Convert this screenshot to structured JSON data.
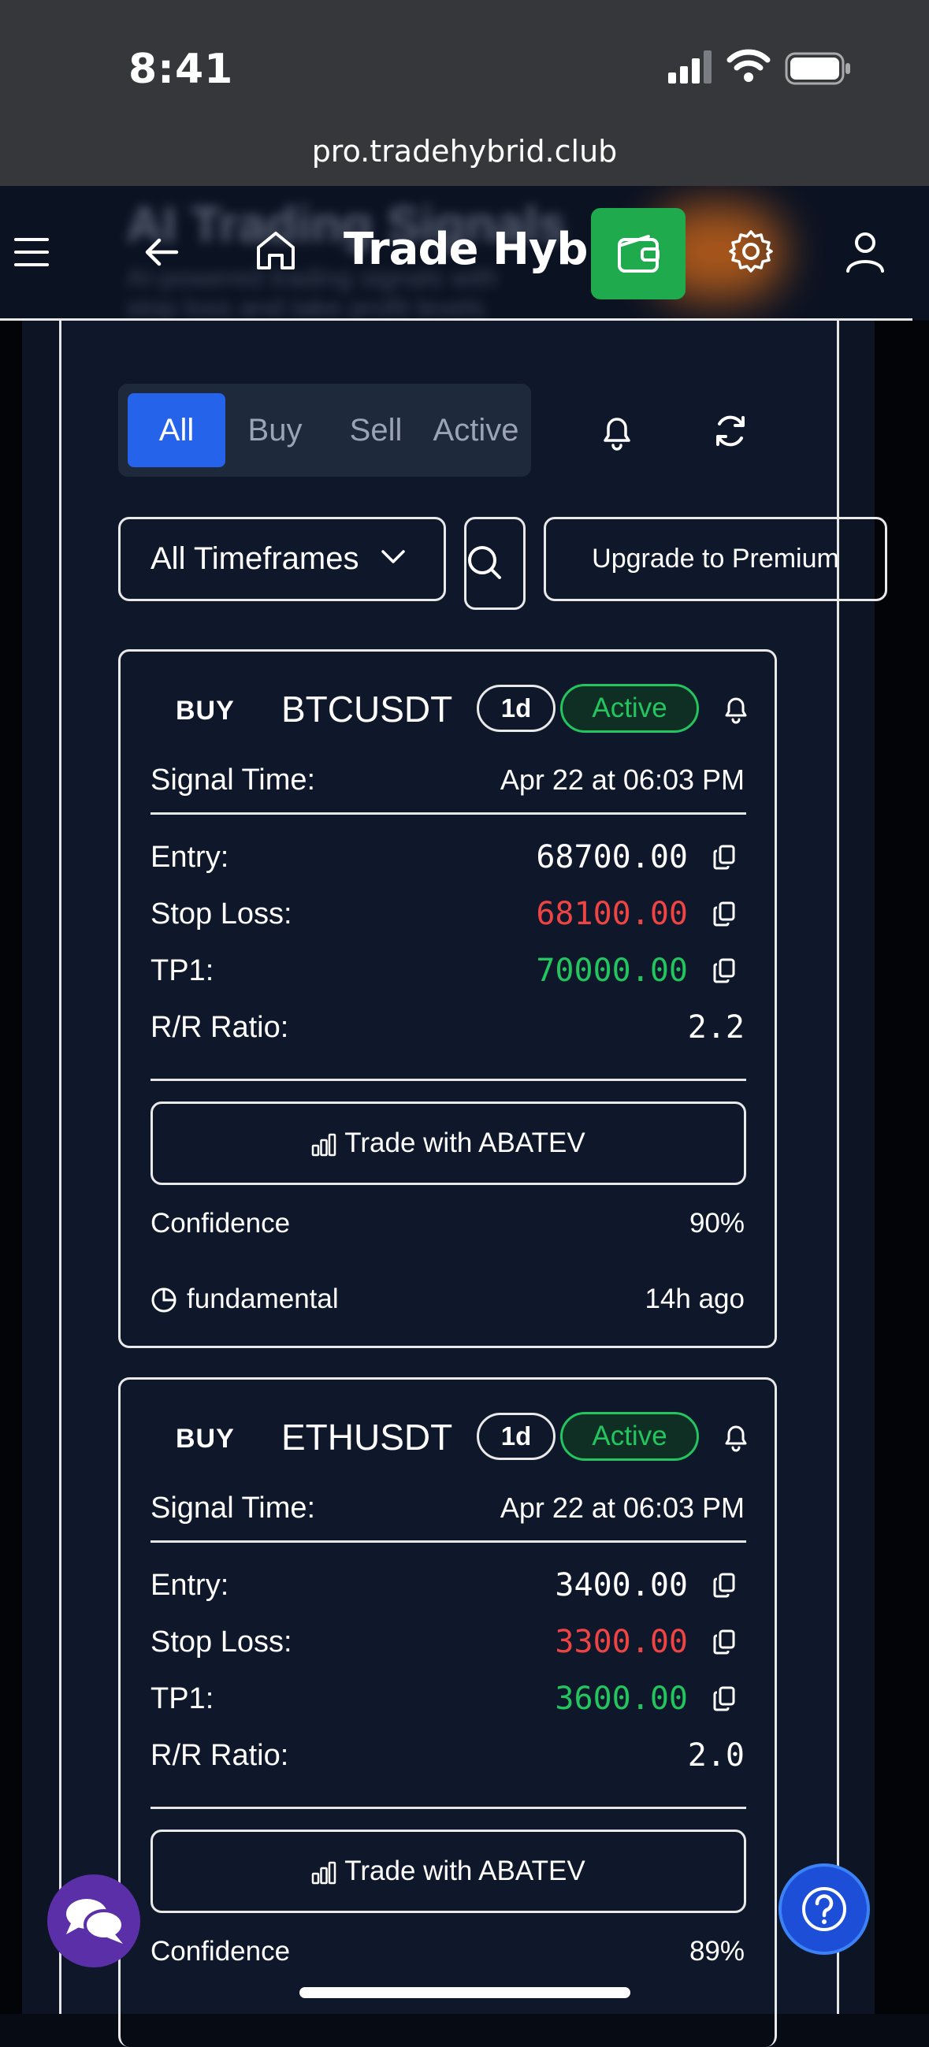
{
  "status_bar": {
    "time": "8:41"
  },
  "browser": {
    "url": "pro.tradehybrid.club"
  },
  "nav": {
    "brand": "Trade Hybrid"
  },
  "background_banner": {
    "title": "AI Trading Signals",
    "line1": "AI-powered trading signals with",
    "line2": "stop loss and take profit levels"
  },
  "filters": {
    "tabs": [
      {
        "label": "All",
        "active": true
      },
      {
        "label": "Buy",
        "active": false
      },
      {
        "label": "Sell",
        "active": false
      },
      {
        "label": "Active",
        "active": false
      }
    ],
    "timeframe": "All Timeframes",
    "upgrade": "Upgrade to Premium"
  },
  "signals": [
    {
      "side": "BUY",
      "symbol": "BTCUSDT",
      "timeframe": "1d",
      "status": "Active",
      "signal_time_label": "Signal Time:",
      "signal_time": "Apr 22 at 06:03 PM",
      "entry_label": "Entry:",
      "entry": "68700.00",
      "stop_label": "Stop Loss:",
      "stop": "68100.00",
      "tp_label": "TP1:",
      "tp": "70000.00",
      "rr_label": "R/R Ratio:",
      "rr": "2.2",
      "trade_button": "Trade with ABATEV",
      "confidence_label": "Confidence",
      "confidence": "90%",
      "source": "fundamental",
      "age": "14h ago"
    },
    {
      "side": "BUY",
      "symbol": "ETHUSDT",
      "timeframe": "1d",
      "status": "Active",
      "signal_time_label": "Signal Time:",
      "signal_time": "Apr 22 at 06:03 PM",
      "entry_label": "Entry:",
      "entry": "3400.00",
      "stop_label": "Stop Loss:",
      "stop": "3300.00",
      "tp_label": "TP1:",
      "tp": "3600.00",
      "rr_label": "R/R Ratio:",
      "rr": "2.0",
      "trade_button": "Trade with ABATEV",
      "confidence_label": "Confidence",
      "confidence": "89%"
    }
  ],
  "colors": {
    "accent": "#2563eb",
    "buy_green": "#22c55e",
    "stop_red": "#ef4444",
    "wallet_green": "#1faa4e"
  },
  "icons": [
    "menu-icon",
    "back-arrow-icon",
    "home-icon",
    "wallet-icon",
    "gear-icon",
    "user-icon",
    "bell-icon",
    "refresh-icon",
    "chevron-down-icon",
    "search-icon",
    "copy-icon",
    "bar-chart-icon",
    "pie-icon",
    "chat-icon",
    "help-icon"
  ]
}
